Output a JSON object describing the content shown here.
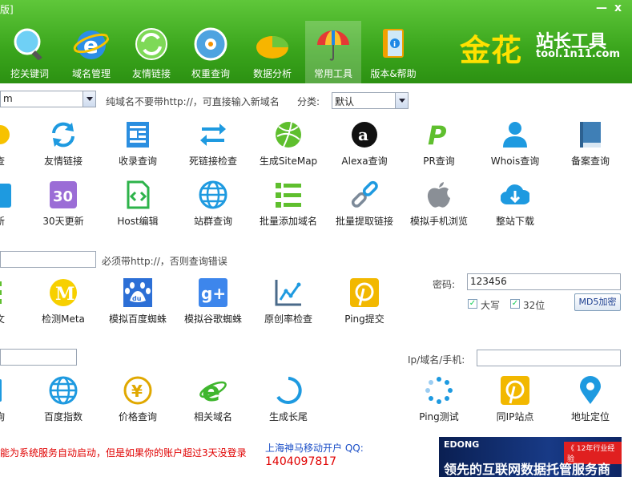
{
  "window": {
    "title": "版]",
    "min_icon": "minimize-icon",
    "close_icon": "close-icon",
    "min_label": "—",
    "close_label": "x"
  },
  "nav": [
    {
      "label": "挖关键词",
      "icon": "magnifier-globe-icon"
    },
    {
      "label": "域名管理",
      "icon": "ie-browser-icon"
    },
    {
      "label": "友情链接",
      "icon": "refresh-arrows-icon"
    },
    {
      "label": "权重查询",
      "icon": "gauge-icon"
    },
    {
      "label": "数据分析",
      "icon": "pie-chart-icon"
    },
    {
      "label": "常用工具",
      "icon": "umbrella-icon",
      "active": true
    },
    {
      "label": "版本&帮助",
      "icon": "help-book-icon"
    }
  ],
  "logo": {
    "main": "金花",
    "sub": "站长工具",
    "url": "tool.1n11.com"
  },
  "row1": {
    "domain_value": "m",
    "hint": "纯域名不要带http://，可直接输入新域名",
    "category_label": "分类:",
    "category_value": "默认"
  },
  "tools1": [
    {
      "label": "查",
      "icon": "partial-icon"
    },
    {
      "label": "友情链接",
      "icon": "refresh-icon"
    },
    {
      "label": "收录查询",
      "icon": "document-icon"
    },
    {
      "label": "死链接检查",
      "icon": "swap-arrows-icon"
    },
    {
      "label": "生成SiteMap",
      "icon": "dribbble-ball-icon"
    },
    {
      "label": "Alexa查询",
      "icon": "alexa-icon"
    },
    {
      "label": "PR查询",
      "icon": "paypal-p-icon"
    },
    {
      "label": "Whois查询",
      "icon": "user-icon"
    },
    {
      "label": "备案查询",
      "icon": "book-icon"
    }
  ],
  "tools2": [
    {
      "label": "新",
      "icon": "partial-icon"
    },
    {
      "label": "30天更新",
      "icon": "calendar-30-icon",
      "badge": "30"
    },
    {
      "label": "Host编辑",
      "icon": "code-file-icon"
    },
    {
      "label": "站群查询",
      "icon": "globe-icon"
    },
    {
      "label": "批量添加域名",
      "icon": "list-icon"
    },
    {
      "label": "批量提取链接",
      "icon": "chain-link-icon"
    },
    {
      "label": "模拟手机浏览",
      "icon": "apple-icon"
    },
    {
      "label": "整站下载",
      "icon": "cloud-download-icon"
    }
  ],
  "row3": {
    "hint": "必须带http://，否则查询错误"
  },
  "tools3": [
    {
      "label": "文",
      "icon": "partial-icon"
    },
    {
      "label": "检测Meta",
      "icon": "meta-m-icon",
      "badge": "M"
    },
    {
      "label": "模拟百度蜘蛛",
      "icon": "baidu-paw-icon"
    },
    {
      "label": "模拟谷歌蜘蛛",
      "icon": "google-plus-icon",
      "badge": "g+"
    },
    {
      "label": "原创率检查",
      "icon": "line-chart-icon"
    },
    {
      "label": "Ping提交",
      "icon": "pinterest-icon"
    }
  ],
  "password": {
    "label": "密码:",
    "value": "123456",
    "upper_label": "大写",
    "bit32_label": "32位",
    "button": "MD5加密"
  },
  "row5": {
    "ip_label": "Ip/域名/手机:"
  },
  "tools4": [
    {
      "label": "询",
      "icon": "partial-icon"
    },
    {
      "label": "百度指数",
      "icon": "globe-icon"
    },
    {
      "label": "价格查询",
      "icon": "yen-coin-icon",
      "badge": "¥"
    },
    {
      "label": "相关域名",
      "icon": "ie-icon"
    },
    {
      "label": "生成长尾",
      "icon": "loading-arc-icon"
    },
    {
      "label": "Ping测试",
      "icon": "spinner-dots-icon"
    },
    {
      "label": "同IP站点",
      "icon": "pinterest-icon"
    },
    {
      "label": "地址定位",
      "icon": "map-pin-icon"
    }
  ],
  "footer": {
    "notice": "能为系统服务自动启动，但是如果你的账户超过3天没登录",
    "contact": "上海神马移动开户 QQ:",
    "qq": "1404097817",
    "banner_brand": "EDONG",
    "banner_tag": "《 12年行业经验",
    "banner_text": "领先的互联网数据托管服务商"
  },
  "colors": {
    "header_green": "#3aa51c",
    "accent_blue": "#1e8ee0",
    "logo_yellow": "#ffe100",
    "notice_red": "#e00000"
  }
}
